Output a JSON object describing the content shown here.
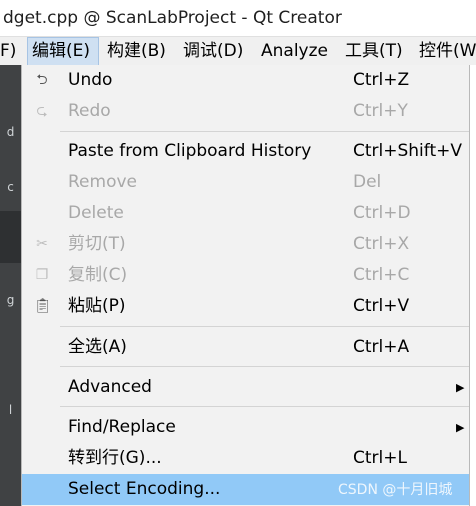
{
  "window": {
    "title": "dget.cpp @ ScanLabProject - Qt Creator"
  },
  "menubar": {
    "items": [
      {
        "label": "F)"
      },
      {
        "label": "编辑(E)"
      },
      {
        "label": "构建(B)"
      },
      {
        "label": "调试(D)"
      },
      {
        "label": "Analyze"
      },
      {
        "label": "工具(T)"
      },
      {
        "label": "控件(W"
      }
    ]
  },
  "editor_strip": {
    "marks": [
      "d",
      "c",
      "g",
      "l"
    ]
  },
  "edit_menu": {
    "undo": {
      "label": "Undo",
      "shortcut": "Ctrl+Z",
      "icon": "undo-icon"
    },
    "redo": {
      "label": "Redo",
      "shortcut": "Ctrl+Y",
      "icon": "redo-icon"
    },
    "paste_history": {
      "label": "Paste from Clipboard History",
      "shortcut": "Ctrl+Shift+V"
    },
    "remove": {
      "label": "Remove",
      "shortcut": "Del"
    },
    "delete": {
      "label": "Delete",
      "shortcut": "Ctrl+D"
    },
    "cut": {
      "label": "剪切(T)",
      "shortcut": "Ctrl+X",
      "icon": "scissors-icon"
    },
    "copy": {
      "label": "复制(C)",
      "shortcut": "Ctrl+C",
      "icon": "copy-icon"
    },
    "paste": {
      "label": "粘贴(P)",
      "shortcut": "Ctrl+V",
      "icon": "paste-icon"
    },
    "select_all": {
      "label": "全选(A)",
      "shortcut": "Ctrl+A"
    },
    "advanced": {
      "label": "Advanced"
    },
    "find_replace": {
      "label": "Find/Replace"
    },
    "goto_line": {
      "label": "转到行(G)...",
      "shortcut": "Ctrl+L"
    },
    "select_encoding": {
      "label": "Select Encoding..."
    }
  },
  "watermark": {
    "text": "CSDN @十月旧城"
  },
  "colors": {
    "menu_bg": "#f2f2f2",
    "selected_bg": "#91c9f7",
    "disabled_text": "#a8a8a8",
    "editor_dark": "#404244"
  }
}
